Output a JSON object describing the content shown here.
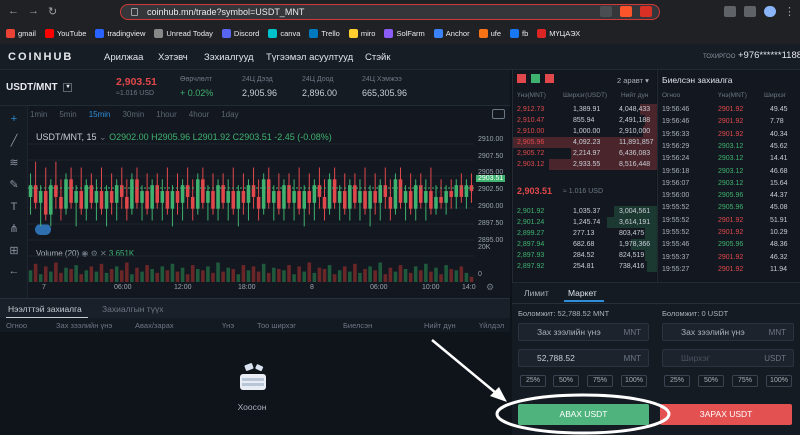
{
  "browser": {
    "url": "coinhub.mn/trade?symbol=USDT_MNT",
    "bookmarks": [
      "gmail",
      "YouTube",
      "tradingview",
      "Unread Today",
      "Discord",
      "canva",
      "Trello",
      "miro",
      "SolFarm",
      "Anchor",
      "ufe",
      "fb",
      "МҮЦАЭХ"
    ],
    "bookmark_colors": [
      "#ea4335",
      "#ff0000",
      "#2962ff",
      "#888888",
      "#5865f2",
      "#00c4cc",
      "#0079bf",
      "#ffd02f",
      "#8b5cf6",
      "#3b82f6",
      "#f97316",
      "#1877f2",
      "#dc2626"
    ]
  },
  "header": {
    "logo": "COINHUB",
    "nav": [
      "Арилжаа",
      "Хэтэвч",
      "Зэхиалгууд",
      "Түгээмэл асуултууд",
      "Стэйк"
    ],
    "account": "ТОХИРГОО",
    "phone": "+976******1188"
  },
  "ticker": {
    "pair": "USDT/MNT",
    "price": "2,903.51",
    "price_usd": "≈1.016 USD",
    "stats": [
      {
        "label": "Өөрчлөлт",
        "value": "+ 0.02%"
      },
      {
        "label": "24Ц Дээд",
        "value": "2,905.96"
      },
      {
        "label": "24Ц Доод",
        "value": "2,896.00"
      },
      {
        "label": "24Ц Хэмжээ",
        "value": "665,305.96"
      }
    ]
  },
  "chart": {
    "intervals": [
      "1min",
      "5min",
      "15min",
      "30min",
      "1hour",
      "4hour",
      "1day"
    ],
    "active_interval": "15min",
    "symbol": "USDT/MNT, 15",
    "ohlc": "O2902.00  H2905.96  L2901.92  C2903.51  -2.45 (-0.08%)",
    "volume_label": "Volume (20)",
    "volume_value": "3.651K",
    "vol_axis": [
      "20K",
      "0"
    ],
    "price_tag": "2903.51",
    "y_ticks": [
      "2910.00",
      "2907.50",
      "2905.00",
      "2902.50",
      "2900.00",
      "2897.50",
      "2895.00"
    ],
    "x_ticks": [
      "7",
      "06:00",
      "12:00",
      "18:00",
      "8",
      "06:00",
      "10:00",
      "14:0"
    ]
  },
  "chart_data": {
    "type": "candlestick",
    "ylim": [
      2894,
      2911
    ],
    "candles": [
      [
        2902,
        2906,
        2899,
        2904
      ],
      [
        2904,
        2908,
        2900,
        2901
      ],
      [
        2901,
        2904,
        2897,
        2903
      ],
      [
        2903,
        2907,
        2898,
        2899
      ],
      [
        2899,
        2905,
        2897,
        2904
      ],
      [
        2904,
        2908,
        2900,
        2902
      ],
      [
        2902,
        2905,
        2898,
        2900
      ],
      [
        2900,
        2906,
        2899,
        2905
      ],
      [
        2905,
        2907,
        2900,
        2901
      ],
      [
        2901,
        2904,
        2897,
        2903
      ],
      [
        2903,
        2907,
        2899,
        2900
      ],
      [
        2900,
        2905,
        2898,
        2904
      ],
      [
        2904,
        2906,
        2900,
        2901
      ],
      [
        2901,
        2905,
        2898,
        2903
      ],
      [
        2903,
        2907,
        2899,
        2900
      ],
      [
        2900,
        2904,
        2897,
        2903
      ],
      [
        2903,
        2906,
        2899,
        2901
      ],
      [
        2901,
        2905,
        2898,
        2904
      ],
      [
        2904,
        2907,
        2900,
        2902
      ],
      [
        2902,
        2905,
        2898,
        2900
      ],
      [
        2900,
        2906,
        2899,
        2905
      ],
      [
        2905,
        2907,
        2900,
        2901
      ],
      [
        2901,
        2904,
        2898,
        2903
      ],
      [
        2903,
        2906,
        2899,
        2900
      ],
      [
        2900,
        2905,
        2898,
        2904
      ],
      [
        2904,
        2906,
        2900,
        2901
      ],
      [
        2901,
        2905,
        2898,
        2903
      ],
      [
        2903,
        2907,
        2899,
        2900
      ],
      [
        2900,
        2904,
        2897,
        2903
      ],
      [
        2903,
        2906,
        2899,
        2901
      ],
      [
        2901,
        2905,
        2898,
        2904
      ],
      [
        2904,
        2907,
        2900,
        2902
      ],
      [
        2902,
        2905,
        2898,
        2900
      ],
      [
        2900,
        2906,
        2899,
        2905
      ],
      [
        2905,
        2907,
        2900,
        2901
      ],
      [
        2901,
        2904,
        2898,
        2903
      ],
      [
        2903,
        2906,
        2899,
        2900
      ],
      [
        2900,
        2905,
        2898,
        2904
      ],
      [
        2904,
        2906,
        2900,
        2901
      ],
      [
        2901,
        2905,
        2898,
        2903
      ],
      [
        2903,
        2907,
        2899,
        2900
      ],
      [
        2900,
        2904,
        2897,
        2903
      ],
      [
        2903,
        2906,
        2899,
        2901
      ],
      [
        2901,
        2905,
        2898,
        2904
      ],
      [
        2904,
        2907,
        2900,
        2902
      ],
      [
        2902,
        2905,
        2898,
        2900
      ],
      [
        2900,
        2906,
        2899,
        2905
      ],
      [
        2905,
        2907,
        2900,
        2901
      ],
      [
        2901,
        2904,
        2898,
        2903
      ],
      [
        2903,
        2906,
        2899,
        2900
      ],
      [
        2900,
        2905,
        2898,
        2904
      ],
      [
        2904,
        2906,
        2900,
        2901
      ],
      [
        2901,
        2905,
        2898,
        2903
      ],
      [
        2903,
        2907,
        2899,
        2900
      ],
      [
        2900,
        2904,
        2897,
        2903
      ],
      [
        2903,
        2906,
        2899,
        2901
      ],
      [
        2901,
        2905,
        2898,
        2904
      ],
      [
        2904,
        2907,
        2900,
        2902
      ],
      [
        2902,
        2905,
        2898,
        2900
      ],
      [
        2900,
        2906,
        2899,
        2905
      ],
      [
        2905,
        2907,
        2900,
        2901
      ],
      [
        2901,
        2904,
        2898,
        2903
      ],
      [
        2903,
        2906,
        2899,
        2900
      ],
      [
        2900,
        2905,
        2898,
        2904
      ],
      [
        2904,
        2906,
        2900,
        2901
      ],
      [
        2901,
        2905,
        2898,
        2903
      ],
      [
        2903,
        2907,
        2899,
        2900
      ],
      [
        2900,
        2904,
        2897,
        2903
      ],
      [
        2903,
        2906,
        2899,
        2901
      ],
      [
        2901,
        2905,
        2898,
        2904
      ],
      [
        2904,
        2907,
        2900,
        2902
      ],
      [
        2902,
        2905,
        2898,
        2900
      ],
      [
        2900,
        2906,
        2899,
        2905
      ],
      [
        2905,
        2907,
        2900,
        2901
      ],
      [
        2901,
        2904,
        2898,
        2903
      ],
      [
        2903,
        2906,
        2899,
        2900
      ],
      [
        2900,
        2905,
        2898,
        2904
      ],
      [
        2904,
        2906,
        2900,
        2901
      ],
      [
        2901,
        2905,
        2898,
        2903
      ],
      [
        2903,
        2907,
        2899,
        2900
      ],
      [
        2900,
        2904,
        2899,
        2902
      ],
      [
        2902,
        2905,
        2900,
        2901
      ],
      [
        2901,
        2904,
        2899,
        2903
      ],
      [
        2903,
        2905,
        2900,
        2902
      ],
      [
        2902,
        2905,
        2900,
        2904
      ],
      [
        2904,
        2906,
        2901,
        2902
      ],
      [
        2902,
        2905,
        2900,
        2904
      ],
      [
        2904,
        2906,
        2901,
        2903
      ]
    ],
    "volume": [
      9,
      14,
      6,
      12,
      8,
      15,
      7,
      11,
      10,
      13,
      6,
      9,
      12,
      8,
      14,
      7,
      10,
      12,
      9,
      15,
      6,
      11,
      8,
      13,
      10,
      7,
      12,
      9,
      14,
      8,
      11,
      6,
      13,
      10,
      9,
      12,
      7,
      15,
      8,
      11,
      10,
      6,
      13,
      9,
      12,
      8,
      14,
      7,
      11,
      10,
      9,
      13,
      6,
      12,
      8,
      15,
      7,
      11,
      10,
      13,
      6,
      9,
      12,
      8,
      14,
      7,
      10,
      12,
      9,
      15,
      6,
      11,
      8,
      13,
      10,
      7,
      12,
      9,
      14,
      8,
      11,
      6,
      13,
      10,
      9,
      12,
      7,
      4
    ]
  },
  "orders_panel": {
    "tabs": [
      "Нээлттэй захиалга",
      "Захиалгын түүх"
    ],
    "columns": [
      "Огноо",
      "Зах зээлийн үнэ",
      "Авах/зарах",
      "Үнэ",
      "Тоо ширхэг",
      "Биелсэн",
      "Нийт дүн",
      "Үйлдэл"
    ],
    "empty_text": "Хоосон"
  },
  "orderbook": {
    "dropdown": "2 аравт",
    "columns": [
      "Үнэ(MNT)",
      "Ширхэг(USDT)",
      "Нийт дүн"
    ],
    "asks": [
      {
        "p": "2,912.73",
        "q": "1,389.91",
        "t": "4,048,433",
        "d": 0.12
      },
      {
        "p": "2,910.47",
        "q": "855.94",
        "t": "2,491,188",
        "d": 0.08
      },
      {
        "p": "2,910.00",
        "q": "1,000.00",
        "t": "2,910,000",
        "d": 0.1
      },
      {
        "p": "2,905.96",
        "q": "4,092.23",
        "t": "11,891,857",
        "d": 1.0
      },
      {
        "p": "2,905.72",
        "q": "2,214.97",
        "t": "6,436,083",
        "d": 0.6
      },
      {
        "p": "2,903.12",
        "q": "2,933.55",
        "t": "8,516,448",
        "d": 0.75
      }
    ],
    "mid_price": "2,903.51",
    "mid_usd": "≈ 1.016 USD",
    "bids": [
      {
        "p": "2,901.92",
        "q": "1,035.37",
        "t": "3,004,561",
        "d": 0.3
      },
      {
        "p": "2,901.24",
        "q": "1,245.74",
        "t": "3,614,191",
        "d": 0.35
      },
      {
        "p": "2,899.27",
        "q": "277.13",
        "t": "803,475",
        "d": 0.08
      },
      {
        "p": "2,897.94",
        "q": "682.68",
        "t": "1,978,366",
        "d": 0.18
      },
      {
        "p": "2,897.93",
        "q": "284.52",
        "t": "824,519",
        "d": 0.08
      },
      {
        "p": "2,897.92",
        "q": "254.81",
        "t": "738,416",
        "d": 0.07
      }
    ]
  },
  "trades": {
    "title": "Биелсэн захиалга",
    "columns": [
      "Огноо",
      "Үнэ(MNT)",
      "Ширхэг"
    ],
    "rows": [
      {
        "t": "19:56:46",
        "p": "2901.92",
        "q": "49.45",
        "s": "sell"
      },
      {
        "t": "19:56:46",
        "p": "2901.92",
        "q": "7.78",
        "s": "sell"
      },
      {
        "t": "19:56:33",
        "p": "2901.92",
        "q": "40.34",
        "s": "sell"
      },
      {
        "t": "19:56:29",
        "p": "2903.12",
        "q": "45.62",
        "s": "buy"
      },
      {
        "t": "19:56:24",
        "p": "2903.12",
        "q": "14.41",
        "s": "buy"
      },
      {
        "t": "19:56:18",
        "p": "2903.12",
        "q": "46.68",
        "s": "buy"
      },
      {
        "t": "19:56:07",
        "p": "2903.12",
        "q": "15.64",
        "s": "buy"
      },
      {
        "t": "19:56:00",
        "p": "2905.96",
        "q": "44.37",
        "s": "buy"
      },
      {
        "t": "19:55:52",
        "p": "2905.96",
        "q": "45.08",
        "s": "buy"
      },
      {
        "t": "19:55:52",
        "p": "2901.92",
        "q": "51.91",
        "s": "sell"
      },
      {
        "t": "19:55:52",
        "p": "2901.92",
        "q": "10.29",
        "s": "sell"
      },
      {
        "t": "19:55:46",
        "p": "2905.96",
        "q": "48.36",
        "s": "buy"
      },
      {
        "t": "19:55:37",
        "p": "2901.92",
        "q": "46.32",
        "s": "sell"
      },
      {
        "t": "19:55:27",
        "p": "2901.92",
        "q": "11.94",
        "s": "sell"
      }
    ]
  },
  "trade_form": {
    "tabs": [
      "Лимит",
      "Маркет"
    ],
    "active_tab": "Маркет",
    "buy": {
      "balance": "Боломжит: 52,788.52 MNT",
      "market_label": "Зах зээлийн үнэ",
      "market_unit": "MNT",
      "amount": "52,788.52",
      "amount_unit": "MNT",
      "button": "АВАХ USDT"
    },
    "sell": {
      "balance": "Боломжит: 0 USDT",
      "market_label": "Зах зээлийн үнэ",
      "market_unit": "MNT",
      "amount_placeholder": "Ширхэг",
      "amount_unit": "USDT",
      "button": "ЗАРАХ USDT"
    },
    "percents": [
      "25%",
      "50%",
      "75%",
      "100%"
    ]
  },
  "colors": {
    "up": "#3fb26f",
    "down": "#e0484b",
    "accent": "#2e8dd8",
    "buy": "#4fb37d",
    "sell": "#e35151"
  }
}
